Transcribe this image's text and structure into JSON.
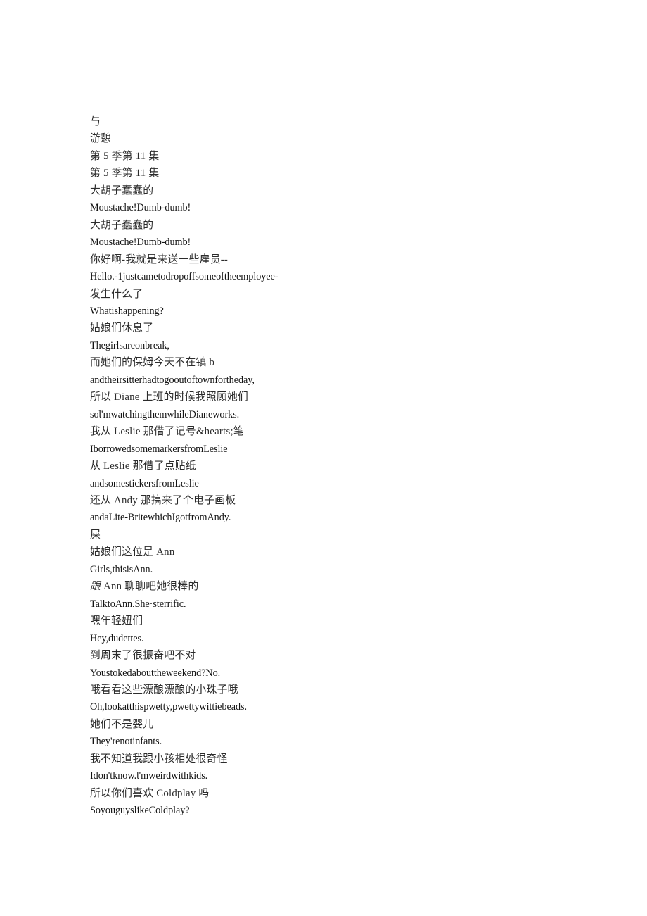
{
  "document": {
    "page_background": "#ffffff",
    "text_color": "#1a1a1a",
    "lines": [
      {
        "id": "line-1",
        "lang": "zh",
        "text": "与"
      },
      {
        "id": "line-2",
        "lang": "zh",
        "text": "游憩"
      },
      {
        "id": "line-3",
        "lang": "zh",
        "text": "第 5 季第 11 集"
      },
      {
        "id": "line-4",
        "lang": "zh",
        "text": "第 5 季第 11 集"
      },
      {
        "id": "line-5",
        "lang": "zh",
        "text": "大胡子蠢蠢的"
      },
      {
        "id": "line-6",
        "lang": "en",
        "text": "Moustache!Dumb-dumb!"
      },
      {
        "id": "line-7",
        "lang": "zh",
        "text": "大胡子蠢蠢的"
      },
      {
        "id": "line-8",
        "lang": "en",
        "text": "Moustache!Dumb-dumb!"
      },
      {
        "id": "line-9",
        "lang": "zh",
        "text": "你好啊-我就是来送一些雇员--"
      },
      {
        "id": "line-10",
        "lang": "en",
        "text": "Hello.-1justcametodropoffsomeoftheemployee-"
      },
      {
        "id": "line-11",
        "lang": "zh",
        "text": "发生什么了"
      },
      {
        "id": "line-12",
        "lang": "en",
        "text": "Whatishappening?"
      },
      {
        "id": "line-13",
        "lang": "zh",
        "text": "姑娘们休息了"
      },
      {
        "id": "line-14",
        "lang": "en",
        "text": "Thegirlsareonbreak,"
      },
      {
        "id": "line-15",
        "lang": "zh",
        "text": "而她们的保姆今天不在镇 b"
      },
      {
        "id": "line-16",
        "lang": "en",
        "text": "andtheirsitterhadtogooutoftownfortheday,"
      },
      {
        "id": "line-17",
        "lang": "zh",
        "text": "所以 Diane 上班的时候我照顾她们"
      },
      {
        "id": "line-18",
        "lang": "en",
        "text": "soƖ'mwatchingthemwhileDianeworks."
      },
      {
        "id": "line-19",
        "lang": "zh",
        "text": "我从 Leslie 那借了记号&hearts;笔"
      },
      {
        "id": "line-20",
        "lang": "en",
        "text": "IborrowedsomemarkersfromLeslie"
      },
      {
        "id": "line-21",
        "lang": "zh",
        "text": "从 Leslie 那借了点贴纸"
      },
      {
        "id": "line-22",
        "lang": "en",
        "text": "andsomestickersfromLeslie"
      },
      {
        "id": "line-23",
        "lang": "zh",
        "text": "还从 Andy 那搞来了个电子画板"
      },
      {
        "id": "line-24",
        "lang": "en",
        "text": "andaLite-BritewhichIgotfromAndy."
      },
      {
        "id": "line-25",
        "lang": "zh",
        "text": "屎"
      },
      {
        "id": "line-26",
        "lang": "zh",
        "text": "姑娘们这位是 Ann"
      },
      {
        "id": "line-27",
        "lang": "en",
        "text": "Girls,thisisAnn."
      },
      {
        "id": "line-28",
        "lang": "zh",
        "text": "跟 Ann 聊聊吧她很棒的",
        "italic_prefix": "跟",
        "rest": " Ann 聊聊吧她很棒的"
      },
      {
        "id": "line-29",
        "lang": "en",
        "text": "TalktoAnn.She·sterrific."
      },
      {
        "id": "line-30",
        "lang": "zh",
        "text": "嘿年轻妞们"
      },
      {
        "id": "line-31",
        "lang": "en",
        "text": "Hey,dudettes."
      },
      {
        "id": "line-32",
        "lang": "zh",
        "text": "到周末了很振奋吧不对"
      },
      {
        "id": "line-33",
        "lang": "en",
        "text": "Youstokedabouttheweekend?No."
      },
      {
        "id": "line-34",
        "lang": "zh",
        "text": "哦看看这些漂酿漂酿的小珠子哦"
      },
      {
        "id": "line-35",
        "lang": "en",
        "text": "Oh,lookatthispwetty,pwettywittiebeads."
      },
      {
        "id": "line-36",
        "lang": "zh",
        "text": "她们不是婴儿"
      },
      {
        "id": "line-37",
        "lang": "en",
        "text": "They'renotinfants."
      },
      {
        "id": "line-38",
        "lang": "zh",
        "text": "我不知道我跟小孩相处很奇怪"
      },
      {
        "id": "line-39",
        "lang": "en",
        "text": "Idon'tknow.Ɩ'mweirdwithkids."
      },
      {
        "id": "line-40",
        "lang": "zh",
        "text": "所以你们喜欢 Coldplay 吗"
      },
      {
        "id": "line-41",
        "lang": "en",
        "text": "SoyouguyslikeColdplay?"
      }
    ]
  }
}
